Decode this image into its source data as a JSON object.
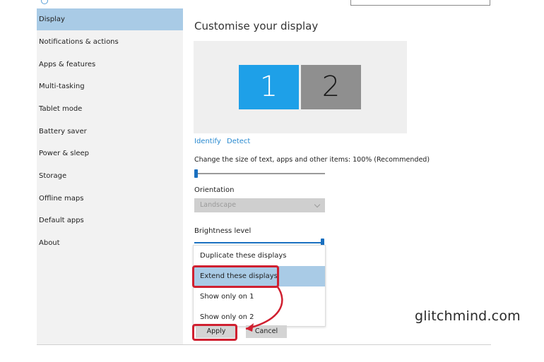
{
  "sidebar": {
    "items": [
      {
        "label": "Display"
      },
      {
        "label": "Notifications & actions"
      },
      {
        "label": "Apps & features"
      },
      {
        "label": "Multi-tasking"
      },
      {
        "label": "Tablet mode"
      },
      {
        "label": "Battery saver"
      },
      {
        "label": "Power & sleep"
      },
      {
        "label": "Storage"
      },
      {
        "label": "Offline maps"
      },
      {
        "label": "Default apps"
      },
      {
        "label": "About"
      }
    ]
  },
  "main": {
    "title": "Customise your display",
    "monitors": [
      "1",
      "2"
    ],
    "identify_label": "Identify",
    "detect_label": "Detect",
    "size_label": "Change the size of text, apps and other items: 100% (Recommended)",
    "orientation_label": "Orientation",
    "orientation_value": "Landscape",
    "brightness_label": "Brightness level",
    "multiple_displays_options": [
      "Duplicate these displays",
      "Extend these displays",
      "Show only on 1",
      "Show only on 2"
    ],
    "selected_option": "Extend these displays",
    "apply_label": "Apply",
    "cancel_label": "Cancel"
  },
  "watermark": "glitchmind.com",
  "colors": {
    "accent": "#1ea0e8",
    "selection": "#a9cbe6",
    "annotation": "#d02030",
    "link": "#2a8ad0"
  }
}
